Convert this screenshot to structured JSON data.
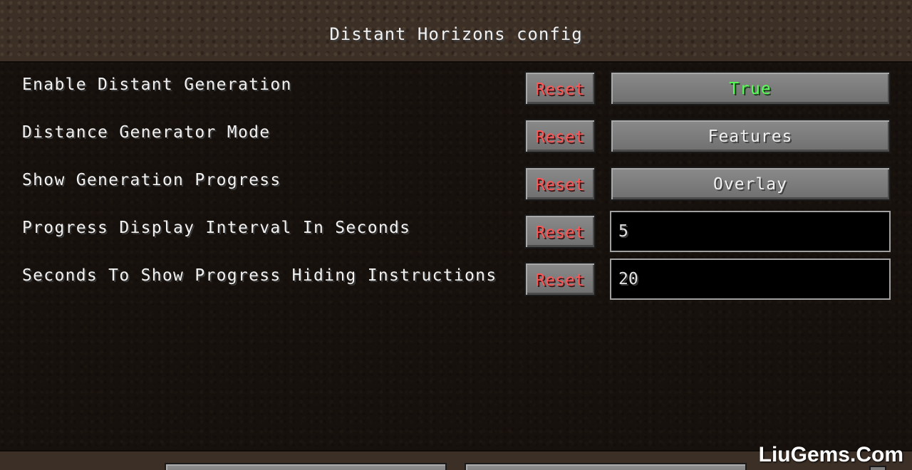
{
  "window": {
    "title": "Distant Horizons config"
  },
  "settings": [
    {
      "label": "Enable Distant Generation",
      "reset_label": "Reset",
      "value": "True",
      "kind": "button"
    },
    {
      "label": "Distance Generator Mode",
      "reset_label": "Reset",
      "value": "Features",
      "kind": "button"
    },
    {
      "label": "Show Generation Progress",
      "reset_label": "Reset",
      "value": "Overlay",
      "kind": "button"
    },
    {
      "label": "Progress Display Interval In Seconds",
      "reset_label": "Reset",
      "value": "5",
      "kind": "field"
    },
    {
      "label": "Seconds To Show Progress Hiding Instructions",
      "reset_label": "Reset",
      "value": "20",
      "kind": "field"
    }
  ],
  "colors": {
    "reset_text": "#ff5555",
    "true_text": "#55ff55",
    "normal_text": "#f0f0f0"
  },
  "watermark": "LiuGems.Com"
}
